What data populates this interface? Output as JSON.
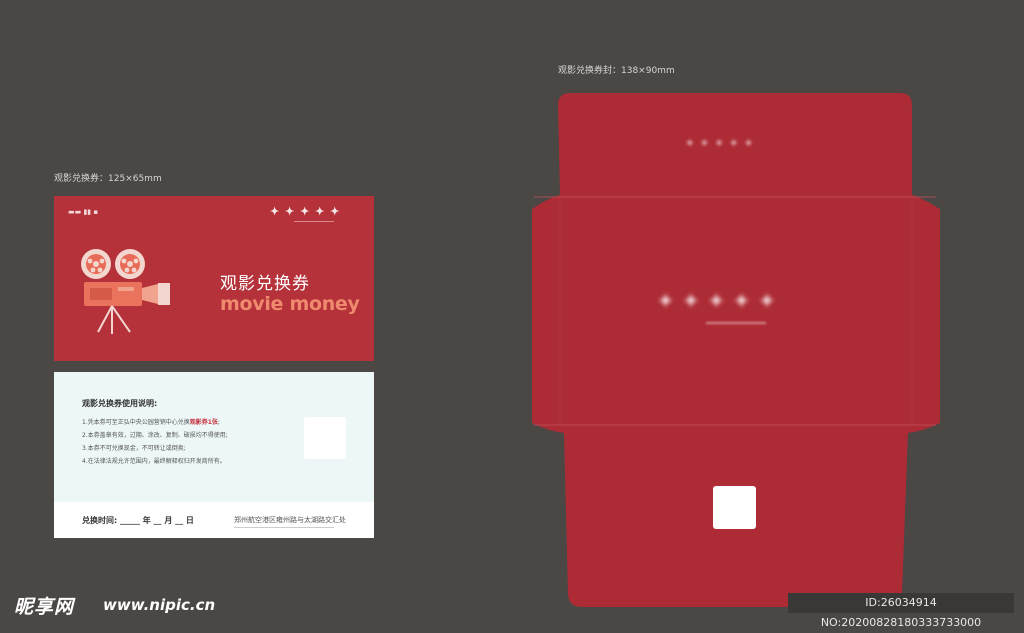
{
  "labels": {
    "ticket": "观影兑换券：125×65mm",
    "envelope": "观影兑换券封：138×90mm"
  },
  "ticket_front": {
    "title_cn": "观影兑换券",
    "title_en": "movie money"
  },
  "ticket_back": {
    "heading": "观影兑换券使用说明:",
    "rule1_a": "1.凭本券可至正弘中央公园营销中心兑换",
    "rule1_b": "观影券1张",
    "rule1_c": ";",
    "rule2": "2.本券盖章有效，过期、涂改、复制、破损均不得使用;",
    "rule3": "3.本券不可兑换现金，不可转让或倒卖;",
    "rule4": "4.在法律法规允许范围内，最终解释权归开发商所有。",
    "date": "兑换时间: _____ 年 __ 月 __ 日",
    "address": "郑州航空港区雍州路与太湖路交汇处"
  },
  "watermark": {
    "logo": "昵享网",
    "url": "www.nipic.cn",
    "id": "ID:26034914 NO:20200828180333733000"
  },
  "colors": {
    "background": "#4a4745",
    "ticket_red": "#b5323a",
    "envelope_red": "#ad2b35",
    "accent_orange": "#ef8a6e",
    "back_panel": "#eef7f8"
  }
}
